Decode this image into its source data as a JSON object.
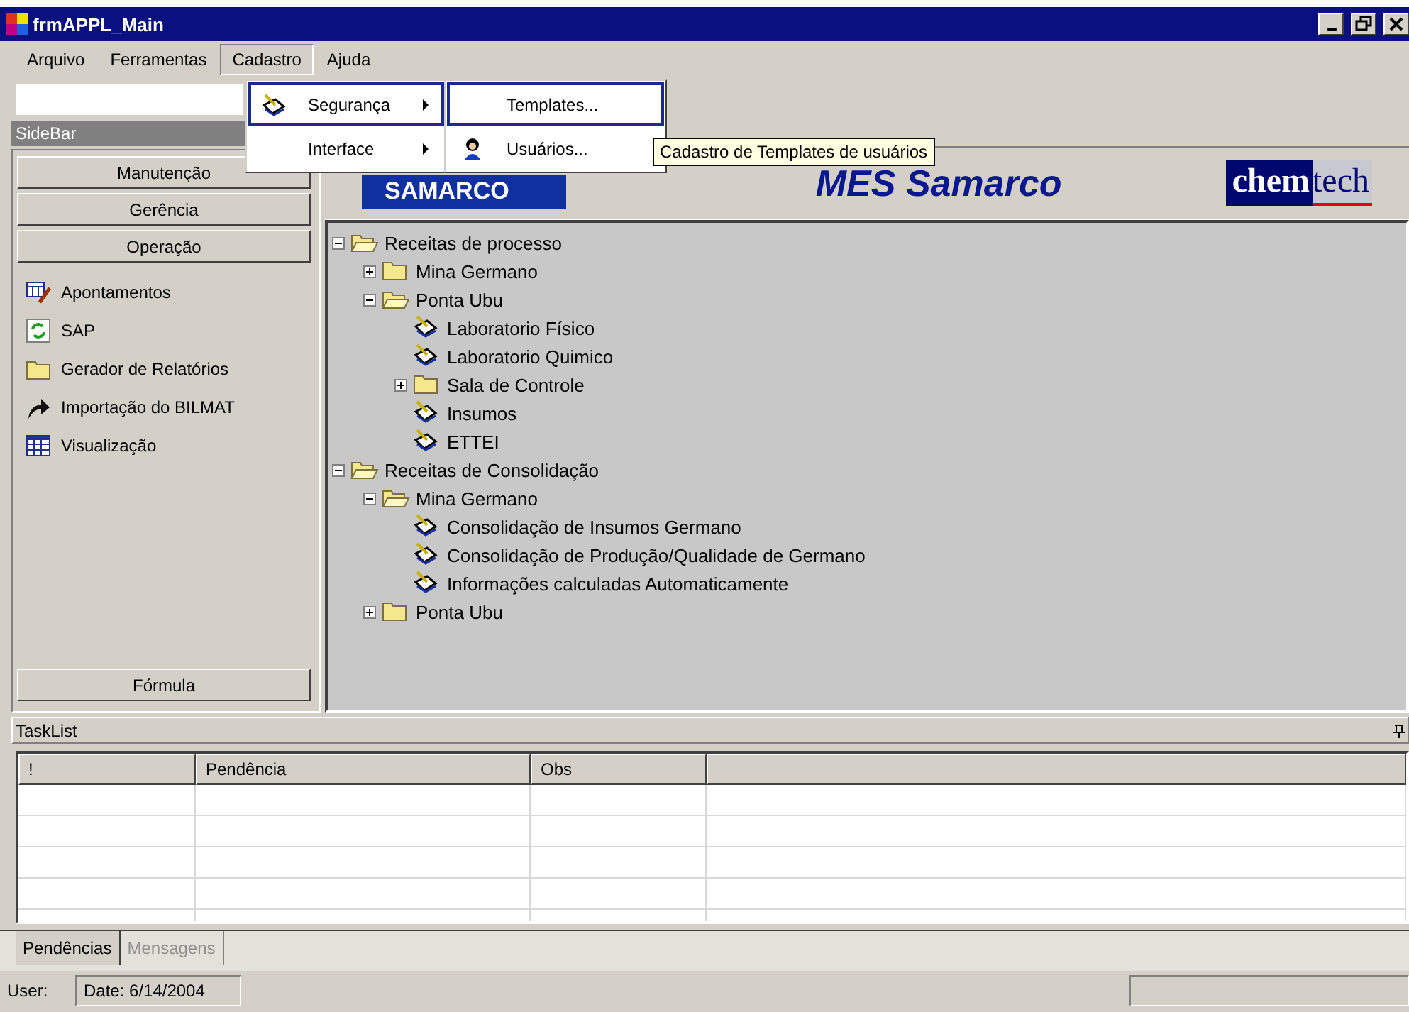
{
  "window": {
    "title": "frmAPPL_Main"
  },
  "menu_bar": [
    {
      "label": "Arquivo",
      "selected": false
    },
    {
      "label": "Ferramentas",
      "selected": false
    },
    {
      "label": "Cadastro",
      "selected": true
    },
    {
      "label": "Ajuda",
      "selected": false
    }
  ],
  "dropdown": [
    {
      "label": "Segurança",
      "kind": "pencil",
      "selected": true
    },
    {
      "label": "Interface",
      "kind": "none",
      "selected": false
    }
  ],
  "submenu": [
    {
      "label": "Templates...",
      "kind": "none",
      "selected": true
    },
    {
      "label": "Usuários...",
      "kind": "person",
      "selected": false
    }
  ],
  "tooltip": "Cadastro de Templates de usuários",
  "sidebar": {
    "header": "SideBar",
    "groups_top": [
      "Manutenção",
      "Gerência",
      "Operação"
    ],
    "items": [
      {
        "label": "Apontamentos",
        "kind": "form"
      },
      {
        "label": "SAP",
        "kind": "sync"
      },
      {
        "label": "Gerador de Relatórios",
        "kind": "folder"
      },
      {
        "label": "Importação do BILMAT",
        "kind": "arrow"
      },
      {
        "label": "Visualização",
        "kind": "grid"
      }
    ],
    "groups_bottom": [
      "Fórmula"
    ]
  },
  "banner": {
    "left_logo": "SAMARCO",
    "title": "MES Samarco",
    "right_logo": {
      "part_1": "chem",
      "part_2": "tech"
    }
  },
  "tree": [
    {
      "label": "Receitas de processo",
      "kind": "folder",
      "expanded": true,
      "children": [
        {
          "label": "Mina Germano",
          "kind": "folder",
          "expanded": false
        },
        {
          "label": "Ponta Ubu",
          "kind": "folder",
          "expanded": true,
          "children": [
            {
              "label": "Laboratorio Físico",
              "kind": "recipe"
            },
            {
              "label": "Laboratorio Quimico",
              "kind": "recipe"
            },
            {
              "label": "Sala de Controle",
              "kind": "folder",
              "expanded": false
            },
            {
              "label": "Insumos",
              "kind": "recipe"
            },
            {
              "label": "ETTEI",
              "kind": "recipe"
            }
          ]
        }
      ]
    },
    {
      "label": "Receitas de Consolidação",
      "kind": "folder",
      "expanded": true,
      "children": [
        {
          "label": "Mina Germano",
          "kind": "folder",
          "expanded": true,
          "children": [
            {
              "label": "Consolidação de Insumos Germano",
              "kind": "recipe"
            },
            {
              "label": "Consolidação de Produção/Qualidade de Germano",
              "kind": "recipe"
            },
            {
              "label": "Informações calculadas Automaticamente",
              "kind": "recipe"
            }
          ]
        },
        {
          "label": "Ponta Ubu",
          "kind": "folder",
          "expanded": false
        }
      ]
    }
  ],
  "tasklist": {
    "title": "TaskList",
    "columns": [
      "!",
      "Pendência",
      "Obs"
    ]
  },
  "tabs": [
    {
      "label": "Pendências",
      "selected": true
    },
    {
      "label": "Mensagens",
      "selected": false
    }
  ],
  "status_bar": {
    "user_label": "User:",
    "date": "Date: 6/14/2004"
  }
}
